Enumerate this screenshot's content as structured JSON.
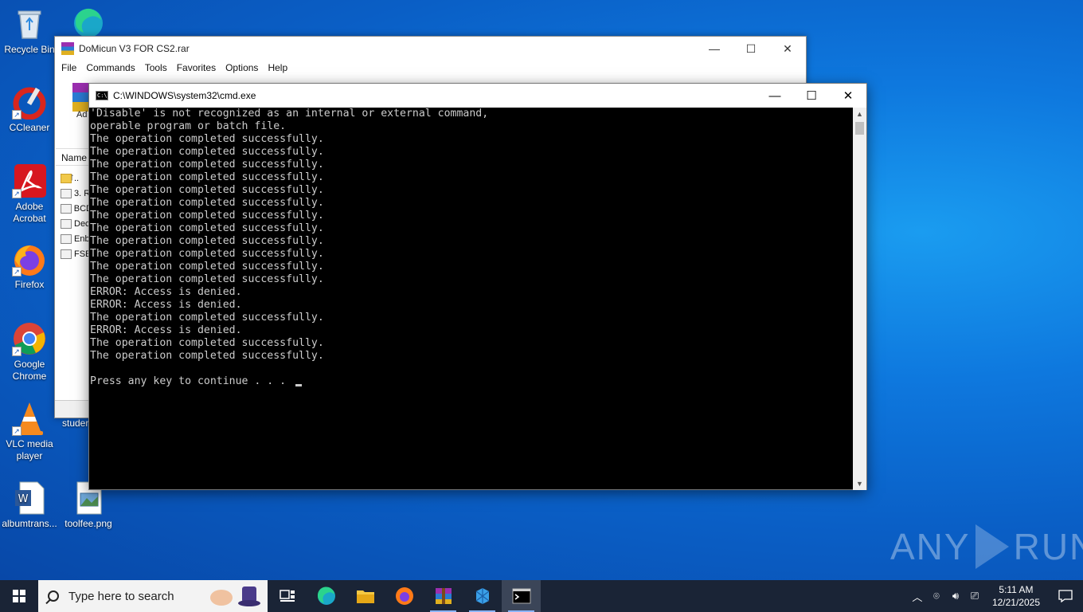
{
  "desktop": {
    "icons": [
      {
        "label": "Recycle Bin"
      },
      {
        "label": "CCleaner"
      },
      {
        "label": "Adobe Acrobat"
      },
      {
        "label": "Firefox"
      },
      {
        "label": "Google Chrome"
      },
      {
        "label": "VLC media player"
      },
      {
        "label": "albumtrans..."
      },
      {
        "label": "toolfee.png"
      },
      {
        "label": "studer"
      }
    ]
  },
  "winrar": {
    "title": "DoMicun V3 FOR CS2.rar",
    "menu": [
      "File",
      "Commands",
      "Tools",
      "Favorites",
      "Options",
      "Help"
    ],
    "toolbar_add_label": "Ad",
    "column_name": "Name",
    "rows": [
      {
        "name": ".."
      },
      {
        "name": "3. R"
      },
      {
        "name": "BCD"
      },
      {
        "name": "Dec"
      },
      {
        "name": "Enb"
      },
      {
        "name": "FSE"
      }
    ],
    "controls": {
      "minimize": "—",
      "maximize": "☐",
      "close": "✕"
    }
  },
  "cmd": {
    "title": "C:\\WINDOWS\\system32\\cmd.exe",
    "lines": [
      "'Disable' is not recognized as an internal or external command,",
      "operable program or batch file.",
      "The operation completed successfully.",
      "The operation completed successfully.",
      "The operation completed successfully.",
      "The operation completed successfully.",
      "The operation completed successfully.",
      "The operation completed successfully.",
      "The operation completed successfully.",
      "The operation completed successfully.",
      "The operation completed successfully.",
      "The operation completed successfully.",
      "The operation completed successfully.",
      "The operation completed successfully.",
      "ERROR: Access is denied.",
      "ERROR: Access is denied.",
      "The operation completed successfully.",
      "ERROR: Access is denied.",
      "The operation completed successfully.",
      "The operation completed successfully.",
      "",
      "Press any key to continue . . . "
    ],
    "controls": {
      "minimize": "—",
      "maximize": "☐",
      "close": "✕"
    }
  },
  "watermark": {
    "left": "ANY",
    "right": "RUN"
  },
  "taskbar": {
    "search_placeholder": "Type here to search",
    "apps": [
      "task-view",
      "edge",
      "file-explorer",
      "firefox",
      "winrar",
      "app-unknown",
      "cmd"
    ],
    "active_app": "cmd",
    "clock_time": "5:11 AM",
    "clock_date": "12/21/2025"
  },
  "colors": {
    "taskbar_bg": "#1a2436",
    "console_bg": "#000000",
    "console_fg": "#cccccc",
    "desktop_accent": "#0e78de"
  }
}
